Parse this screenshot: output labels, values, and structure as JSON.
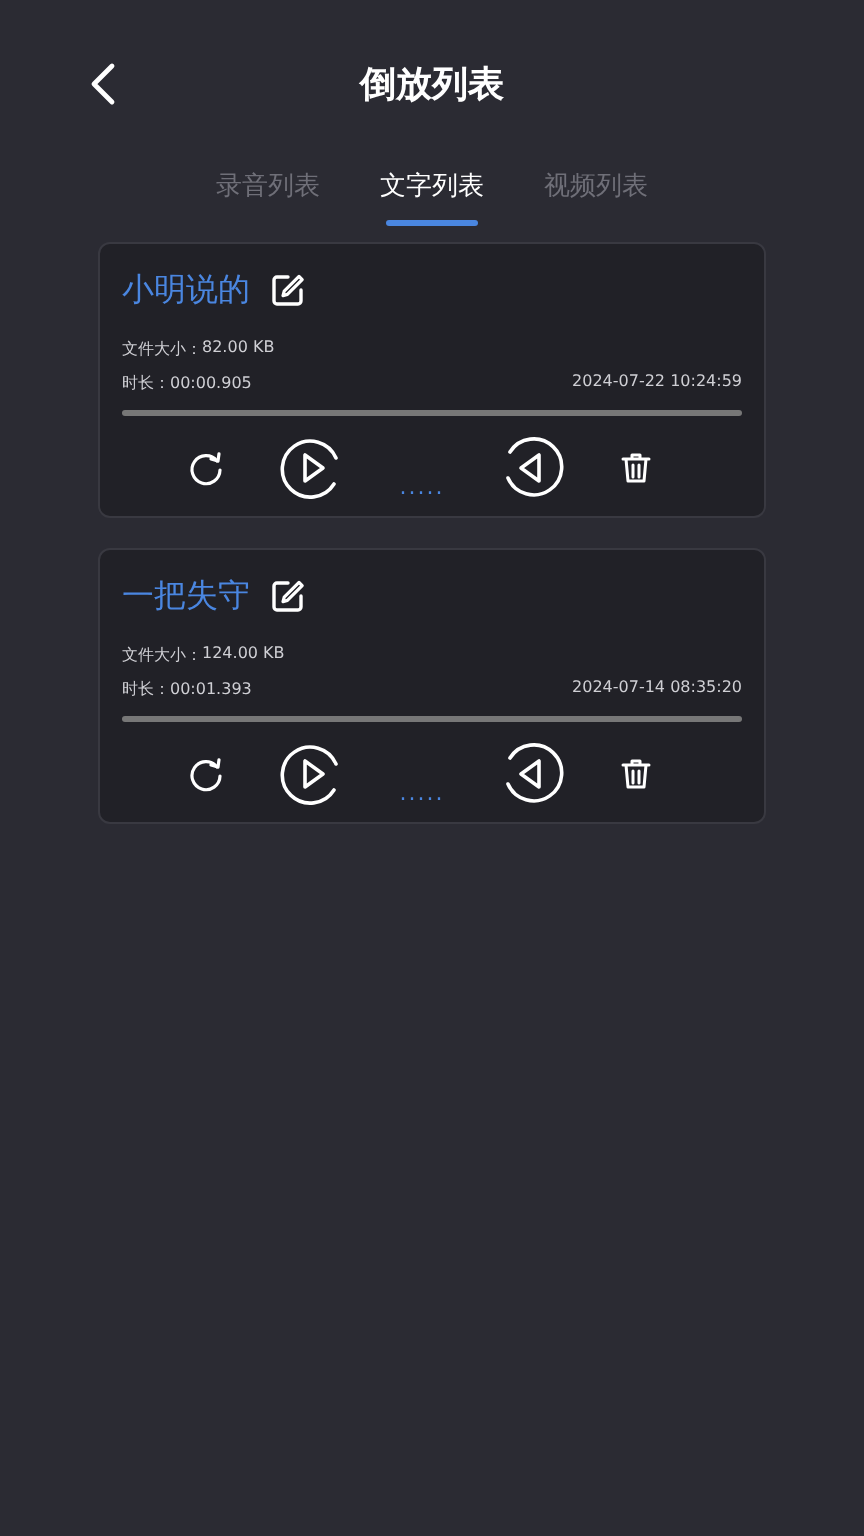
{
  "header": {
    "title": "倒放列表"
  },
  "tabs": [
    {
      "label": "录音列表",
      "selected": false
    },
    {
      "label": "文字列表",
      "selected": true
    },
    {
      "label": "视频列表",
      "selected": false
    }
  ],
  "items": [
    {
      "name": "小明说的",
      "size_label": "文件大小：",
      "size": "82.00 KB",
      "duration_label": "时长：",
      "duration": "00:00.905",
      "date": "2024-07-22 10:24:59",
      "dots": "....."
    },
    {
      "name": "一把失守",
      "size_label": "文件大小：",
      "size": "124.00 KB",
      "duration_label": "时长：",
      "duration": "00:01.393",
      "date": "2024-07-14 08:35:20",
      "dots": "....."
    }
  ]
}
